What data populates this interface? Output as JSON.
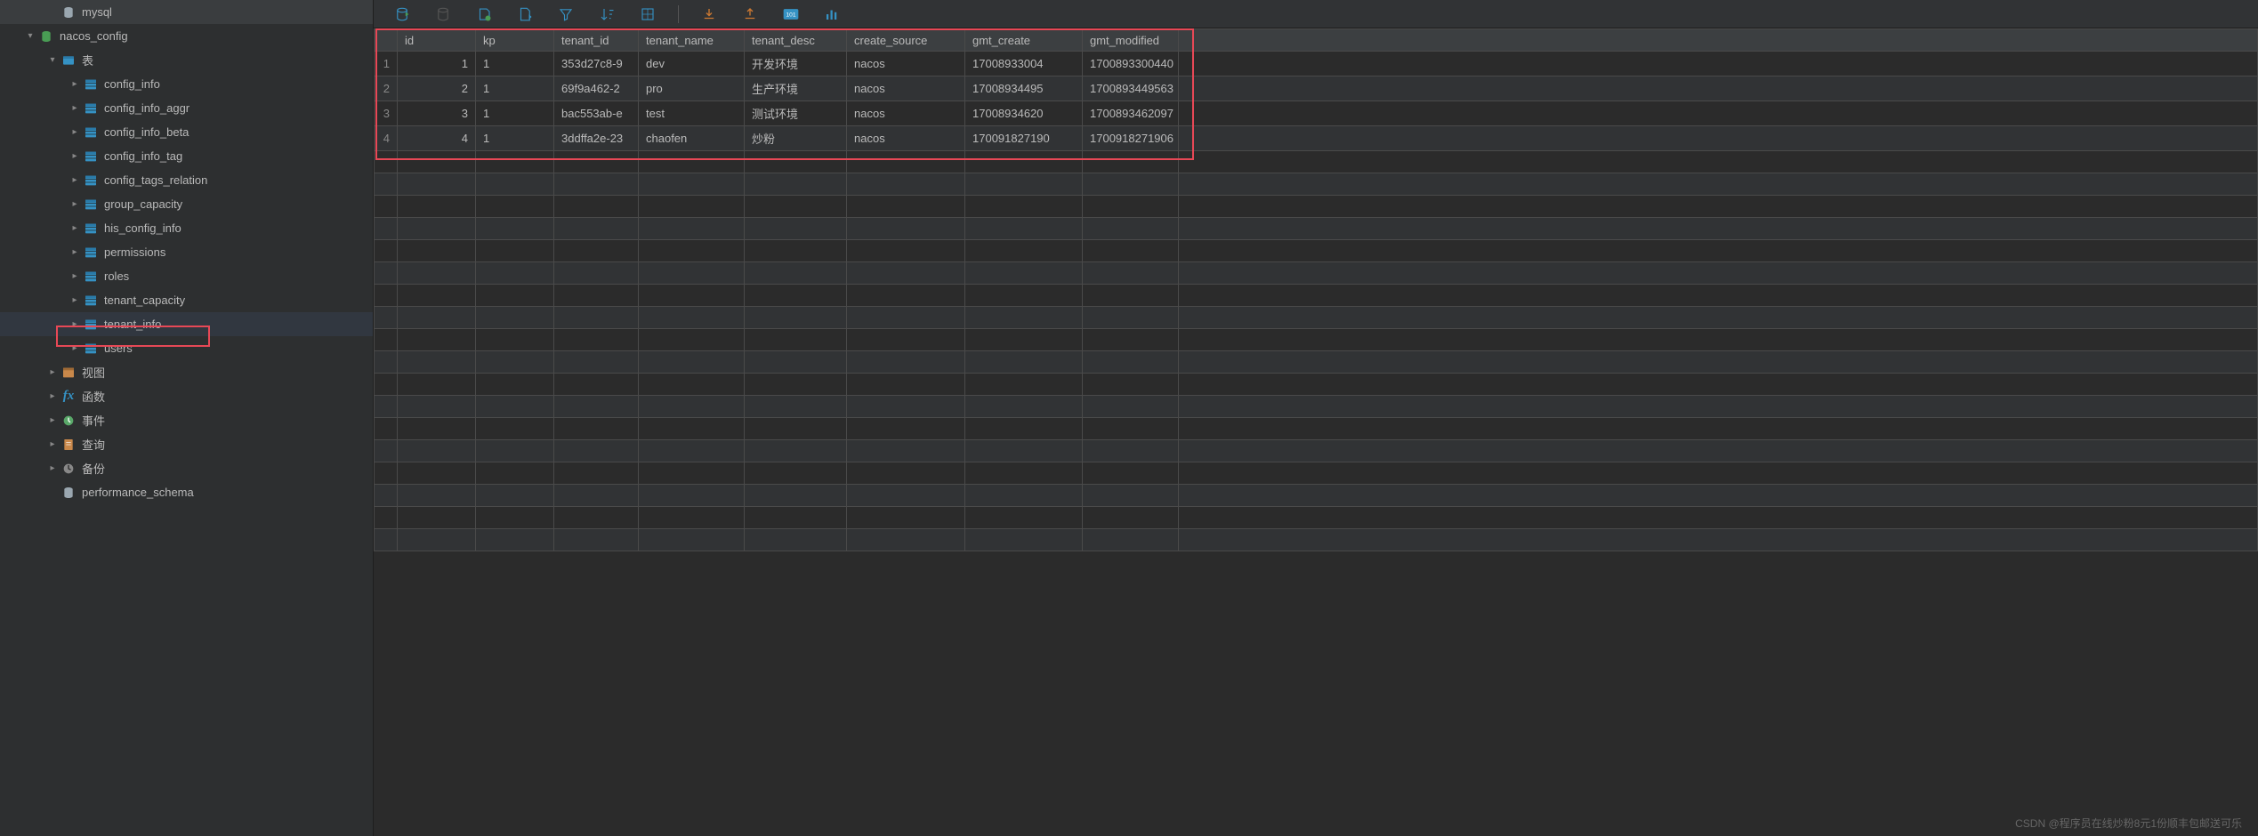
{
  "sidebar": {
    "items": [
      {
        "label": "mysql",
        "icon": "db",
        "indent": 50,
        "chev": ""
      },
      {
        "label": "nacos_config",
        "icon": "schema",
        "indent": 25,
        "chev": "down"
      },
      {
        "label": "表",
        "icon": "folder",
        "indent": 50,
        "chev": "down"
      },
      {
        "label": "config_info",
        "icon": "table",
        "indent": 75,
        "chev": "right"
      },
      {
        "label": "config_info_aggr",
        "icon": "table",
        "indent": 75,
        "chev": "right"
      },
      {
        "label": "config_info_beta",
        "icon": "table",
        "indent": 75,
        "chev": "right"
      },
      {
        "label": "config_info_tag",
        "icon": "table",
        "indent": 75,
        "chev": "right"
      },
      {
        "label": "config_tags_relation",
        "icon": "table",
        "indent": 75,
        "chev": "right"
      },
      {
        "label": "group_capacity",
        "icon": "table",
        "indent": 75,
        "chev": "right"
      },
      {
        "label": "his_config_info",
        "icon": "table",
        "indent": 75,
        "chev": "right"
      },
      {
        "label": "permissions",
        "icon": "table",
        "indent": 75,
        "chev": "right"
      },
      {
        "label": "roles",
        "icon": "table",
        "indent": 75,
        "chev": "right"
      },
      {
        "label": "tenant_capacity",
        "icon": "table",
        "indent": 75,
        "chev": "right"
      },
      {
        "label": "tenant_info",
        "icon": "table",
        "indent": 75,
        "chev": "right",
        "selected": true
      },
      {
        "label": "users",
        "icon": "table",
        "indent": 75,
        "chev": "right"
      },
      {
        "label": "视图",
        "icon": "view",
        "indent": 50,
        "chev": "right"
      },
      {
        "label": "函数",
        "icon": "fx",
        "indent": 50,
        "chev": "right"
      },
      {
        "label": "事件",
        "icon": "event",
        "indent": 50,
        "chev": "right"
      },
      {
        "label": "查询",
        "icon": "query",
        "indent": 50,
        "chev": "right"
      },
      {
        "label": "备份",
        "icon": "backup",
        "indent": 50,
        "chev": "right"
      },
      {
        "label": "performance_schema",
        "icon": "db",
        "indent": 50,
        "chev": ""
      }
    ]
  },
  "columns": [
    "id",
    "kp",
    "tenant_id",
    "tenant_name",
    "tenant_desc",
    "create_source",
    "gmt_create",
    "gmt_modified"
  ],
  "rows": [
    {
      "idx": "1",
      "id": "1",
      "kp": "1",
      "tenant_id": "353d27c8-9",
      "tenant_name": "dev",
      "tenant_desc": "开发环境",
      "create_source": "nacos",
      "gmt_create": "17008933004",
      "gmt_modified": "1700893300440"
    },
    {
      "idx": "2",
      "id": "2",
      "kp": "1",
      "tenant_id": "69f9a462-2",
      "tenant_name": "pro",
      "tenant_desc": "生产环境",
      "create_source": "nacos",
      "gmt_create": "17008934495",
      "gmt_modified": "1700893449563"
    },
    {
      "idx": "3",
      "id": "3",
      "kp": "1",
      "tenant_id": "bac553ab-e",
      "tenant_name": "test",
      "tenant_desc": "测试环境",
      "create_source": "nacos",
      "gmt_create": "17008934620",
      "gmt_modified": "1700893462097"
    },
    {
      "idx": "4",
      "id": "4",
      "kp": "1",
      "tenant_id": "3ddffa2e-23",
      "tenant_name": "chaofen",
      "tenant_desc": "炒粉",
      "create_source": "nacos",
      "gmt_create": "170091827190",
      "gmt_modified": "1700918271906"
    }
  ],
  "watermark": "CSDN @程序员在线炒粉8元1份顺丰包邮送可乐"
}
